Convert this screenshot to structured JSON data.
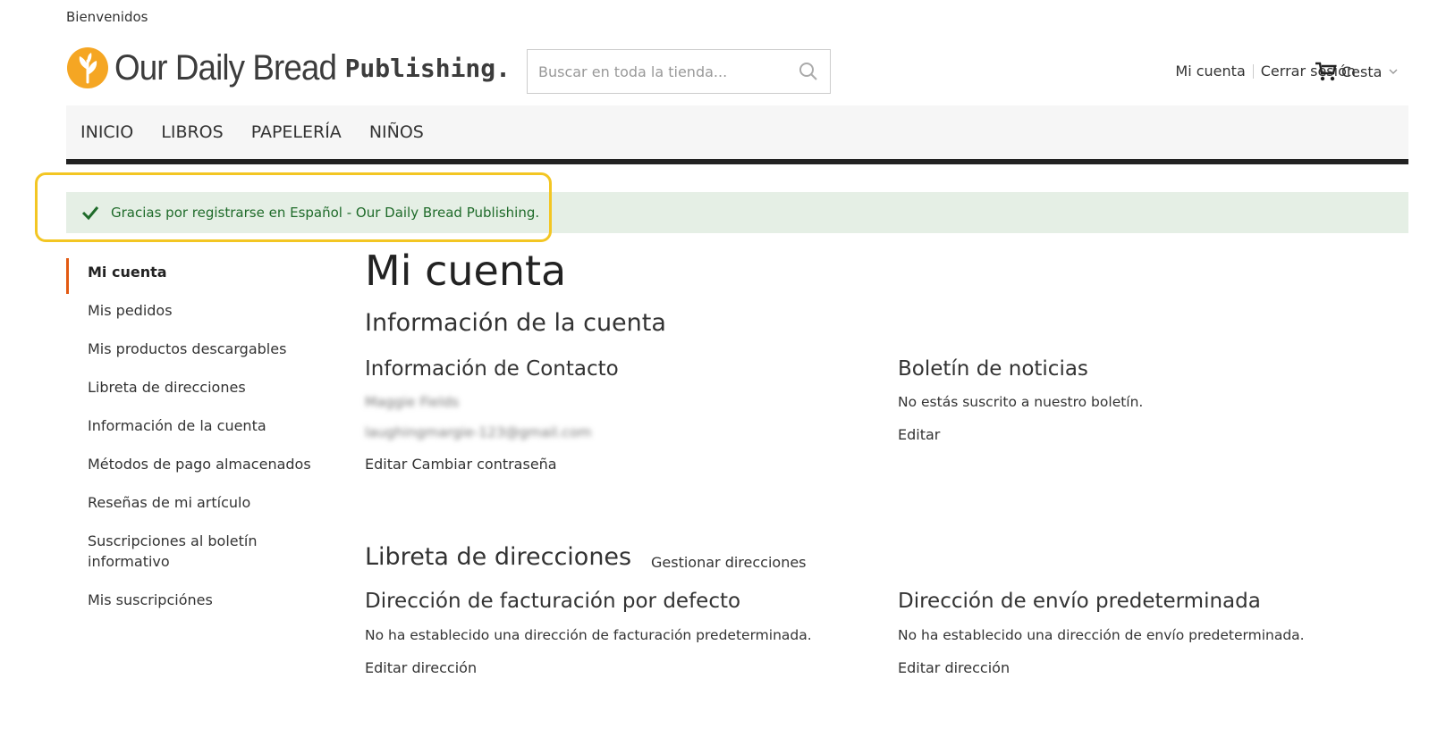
{
  "header": {
    "welcome": "Bienvenidos",
    "logo_main": "Our Daily Bread",
    "logo_sub": "Publishing.",
    "search_placeholder": "Buscar en toda la tienda...",
    "my_account": "Mi cuenta",
    "logout": "Cerrar sesión",
    "cart": "Cesta"
  },
  "nav": [
    "INICIO",
    "LIBROS",
    "PAPELERÍA",
    "NIÑOS"
  ],
  "message": "Gracias por registrarse en Español - Our Daily Bread Publishing.",
  "sidebar": [
    "Mi cuenta",
    "Mis pedidos",
    "Mis productos descargables",
    "Libreta de direcciones",
    "Información de la cuenta",
    "Métodos de pago almacenados",
    "Reseñas de mi artículo",
    "Suscripciones al boletín informativo",
    "Mis suscripciónes"
  ],
  "main": {
    "title": "Mi cuenta",
    "account_info_title": "Información de la cuenta",
    "contact": {
      "title": "Información de Contacto",
      "name": "Maggie Fields",
      "email": "laughingmargie-123@gmail.com",
      "edit": "Editar",
      "change_password": "Cambiar contraseña"
    },
    "newsletter": {
      "title": "Boletín de noticias",
      "text": "No estás suscrito a nuestro boletín.",
      "edit": "Editar"
    },
    "address_book": {
      "title": "Libreta de direcciones",
      "manage": "Gestionar direcciones"
    },
    "billing": {
      "title": "Dirección de facturación por defecto",
      "text": "No ha establecido una dirección de facturación predeterminada.",
      "edit": "Editar dirección"
    },
    "shipping": {
      "title": "Dirección de envío predeterminada",
      "text": "No ha establecido una dirección de envío predeterminada.",
      "edit": "Editar dirección"
    }
  },
  "colors": {
    "accent": "#e25a12",
    "logo": "#f5a623",
    "success_bg": "#e5efe5",
    "success_text": "#1f6b2a",
    "highlight": "#f3c623"
  }
}
